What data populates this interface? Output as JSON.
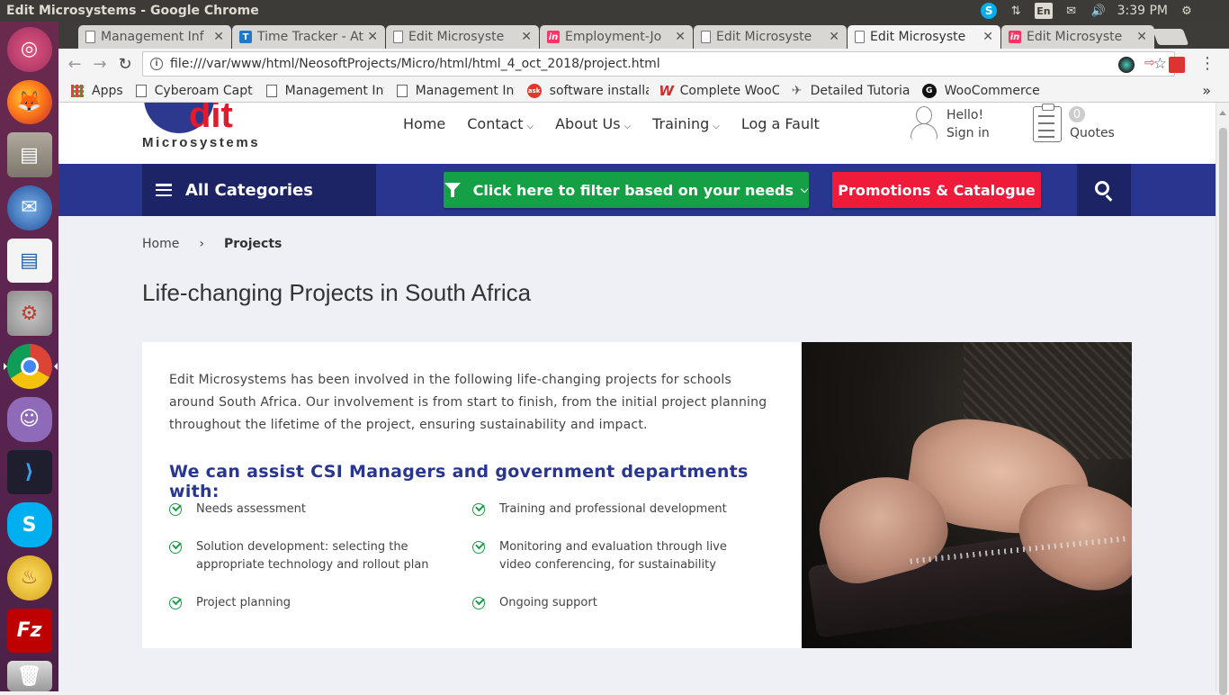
{
  "system": {
    "window_title": "Edit Microsystems - Google Chrome",
    "keyboard_layout": "En",
    "clock": "3:39 PM"
  },
  "tabs": [
    {
      "label": "Management Inf",
      "icon": "doc-icon"
    },
    {
      "label": "Time Tracker - At",
      "icon": "time-tracker-icon"
    },
    {
      "label": "Edit Microsyste",
      "icon": "doc-icon"
    },
    {
      "label": "Employment-Jo",
      "icon": "invision-icon"
    },
    {
      "label": "Edit Microsyste",
      "icon": "doc-icon"
    },
    {
      "label": "Edit Microsyste",
      "icon": "doc-icon",
      "active": true
    },
    {
      "label": "Edit Microsyste",
      "icon": "invision-icon"
    }
  ],
  "toolbar": {
    "url": "file:///var/www/html/NeosoftProjects/Micro/html/html_4_oct_2018/project.html"
  },
  "bookmarks": [
    {
      "label": "Apps",
      "icon": "apps-icon"
    },
    {
      "label": "Cyberoam Capti",
      "icon": "doc-icon"
    },
    {
      "label": "Management Inf",
      "icon": "doc-icon"
    },
    {
      "label": "Management Inf",
      "icon": "doc-icon"
    },
    {
      "label": "software installa",
      "icon": "ask-icon"
    },
    {
      "label": "Complete WooC",
      "icon": "woo-icon"
    },
    {
      "label": "Detailed Tutorial",
      "icon": "drone-icon"
    },
    {
      "label": "WooCommerce T",
      "icon": "g-icon"
    }
  ],
  "site": {
    "logo_text": "dit",
    "logo_subtext": "Microsystems",
    "nav": [
      "Home",
      "Contact",
      "About Us",
      "Training",
      "Log a Fault"
    ],
    "user": {
      "greeting": "Hello!",
      "signin": "Sign in"
    },
    "quotes": {
      "count": "0",
      "label": "Quotes"
    },
    "all_categories": "All Categories",
    "filter_label": "Click here to filter based on your needs",
    "promo_label": "Promotions & Catalogue",
    "breadcrumb": {
      "home": "Home",
      "separator": "›",
      "current": "Projects"
    },
    "page_title": "Life-changing Projects in South Africa",
    "intro": "Edit Microsystems has been involved in the following life-changing projects for schools around South Africa. Our involvement is from start to finish, from the initial project planning throughout the lifetime of the project, ensuring sustainability and impact.",
    "subheading": "We can assist CSI Managers and government departments with:",
    "features": [
      {
        "line1": "Needs assessment",
        "line2": ""
      },
      {
        "line1": "Training and professional development",
        "line2": ""
      },
      {
        "line1": "Solution development: selecting the",
        "line2": "appropriate technology and rollout plan"
      },
      {
        "line1": "Monitoring and evaluation through live",
        "line2": "video conferencing, for sustainability"
      },
      {
        "line1": "Project planning",
        "line2": ""
      },
      {
        "line1": "Ongoing support",
        "line2": ""
      }
    ]
  },
  "colors": {
    "brand_blue": "#283690",
    "brand_dark_blue": "#1c2465",
    "filter_green": "#15a045",
    "promo_red": "#ee1b3a",
    "logo_red": "#e21b2c"
  }
}
